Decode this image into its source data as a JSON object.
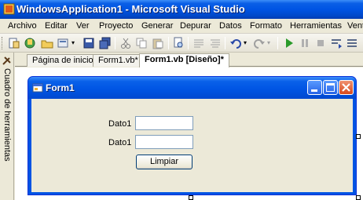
{
  "window": {
    "title": "WindowsApplication1 - Microsoft Visual Studio"
  },
  "menu": {
    "items": [
      "Archivo",
      "Editar",
      "Ver",
      "Proyecto",
      "Generar",
      "Depurar",
      "Datos",
      "Formato",
      "Herramientas",
      "Vent"
    ]
  },
  "toolbox": {
    "label": "Cuadro de herramientas"
  },
  "tabs": [
    {
      "label": "Página de inicio"
    },
    {
      "label": "Form1.vb*"
    },
    {
      "label": "Form1.vb [Diseño]*"
    }
  ],
  "form": {
    "title": "Form1",
    "label1": "Dato1",
    "label2": "Dato1",
    "textbox1_value": "",
    "textbox2_value": "",
    "button_label": "Limpiar"
  },
  "colors": {
    "titlebar": "#0054e3",
    "accent": "#0a246a",
    "close_button": "#d8491c"
  }
}
